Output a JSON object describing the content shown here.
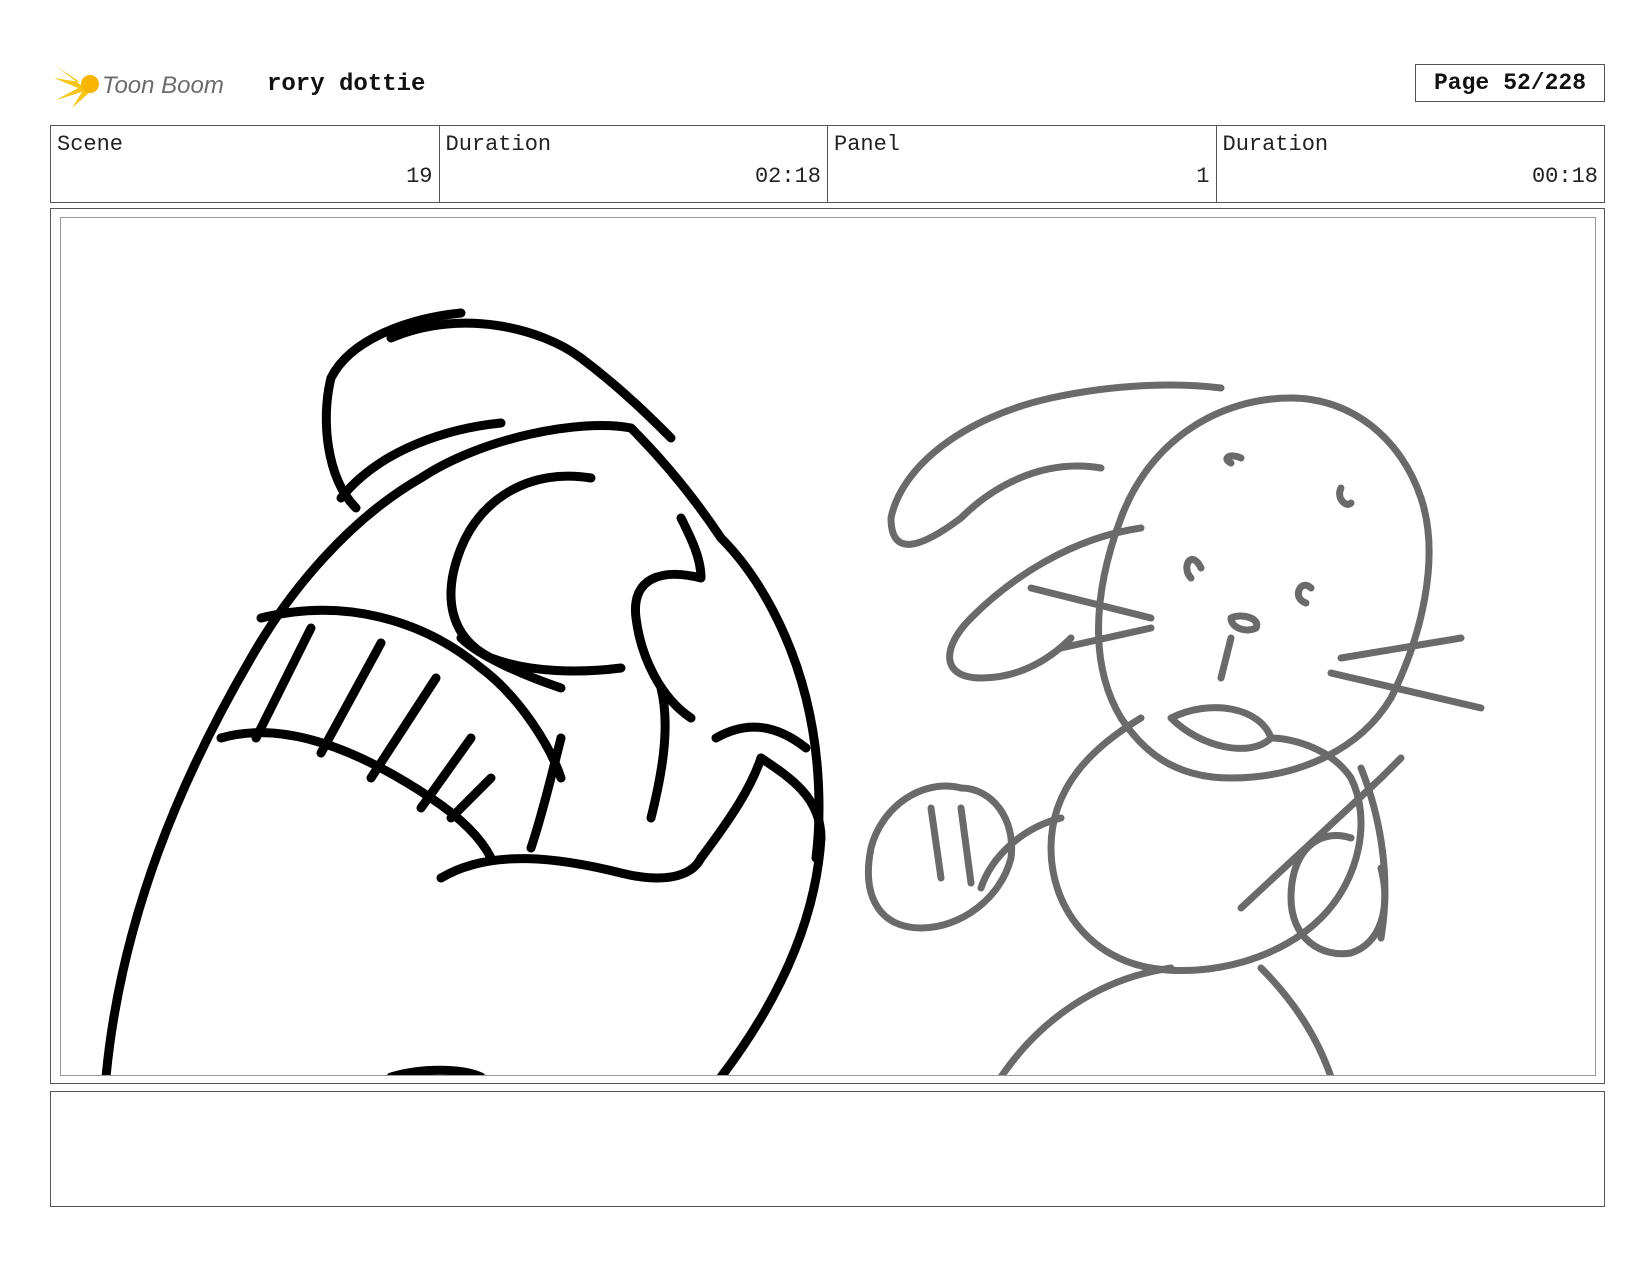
{
  "header": {
    "logo_text": "Toon Boom",
    "project_title": "rory dottie",
    "page_label": "Page",
    "page_number": "52/228"
  },
  "info": {
    "scene_label": "Scene",
    "scene_value": "19",
    "scene_duration_label": "Duration",
    "scene_duration_value": "02:18",
    "panel_label": "Panel",
    "panel_value": "1",
    "panel_duration_label": "Duration",
    "panel_duration_value": "00:18"
  },
  "notes": {
    "text": ""
  },
  "colors": {
    "logo_accent": "#f5c518",
    "logo_text": "#6b6b6b",
    "foreground_ink": "#000000",
    "background_ink": "#6a6a6a"
  }
}
